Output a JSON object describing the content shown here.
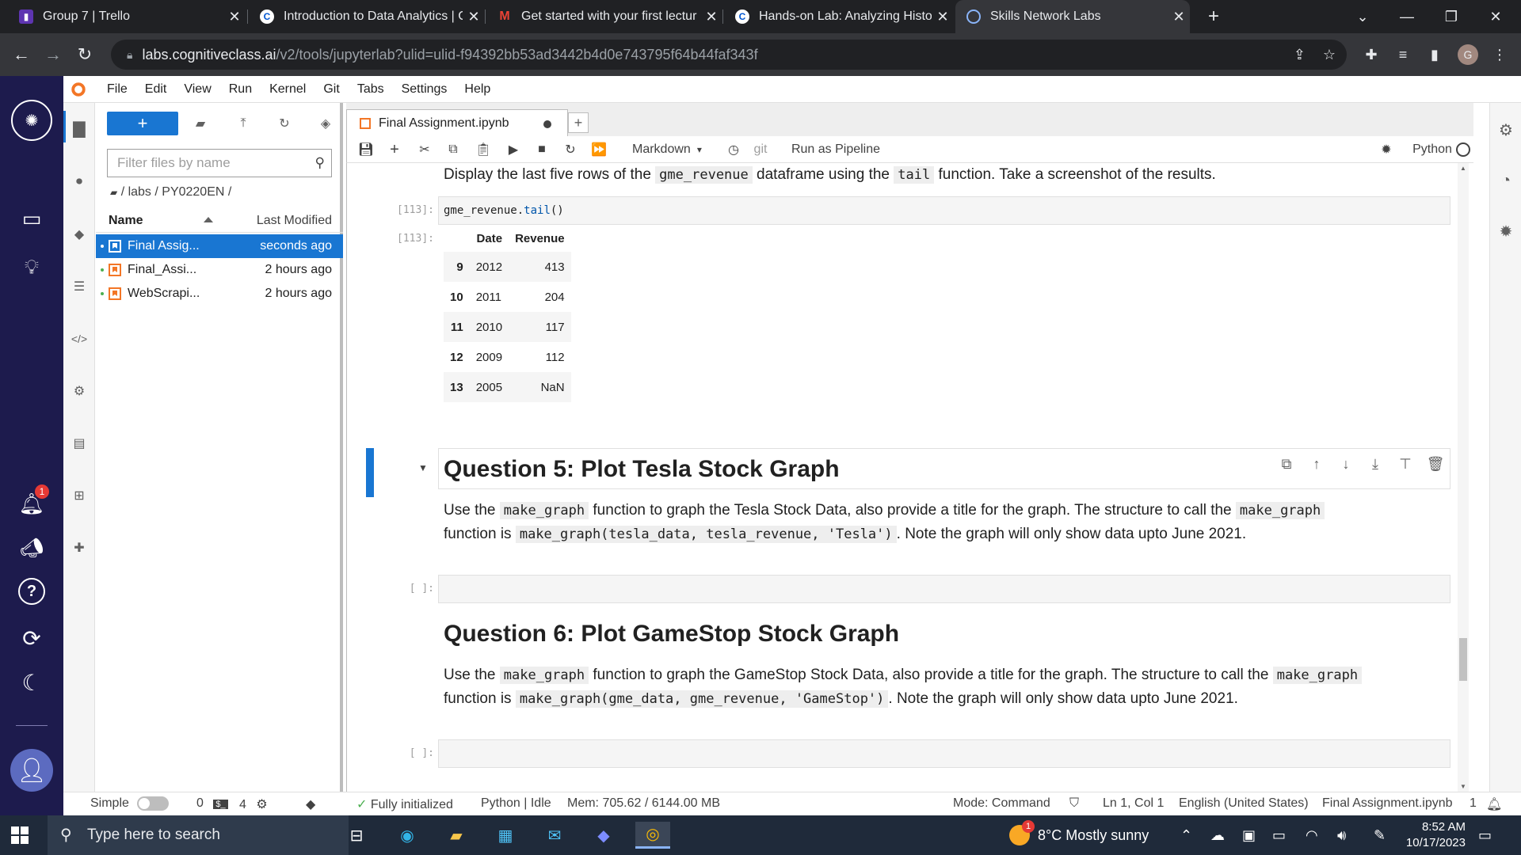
{
  "browser": {
    "tabs": [
      {
        "title": "Group 7 | Trello",
        "icon": "trello-icon",
        "color": "#5e35b1"
      },
      {
        "title": "Introduction to Data Analytics | C",
        "icon": "coursera-icon",
        "color": "#0056d2"
      },
      {
        "title": "Get started with your first lectur",
        "icon": "gmail-icon",
        "color": "#ea4335"
      },
      {
        "title": "Hands-on Lab: Analyzing Histori",
        "icon": "coursera-icon",
        "color": "#0056d2"
      },
      {
        "title": "Skills Network Labs",
        "icon": "skills-network-icon",
        "color": "#8ab4f8"
      }
    ],
    "url_host": "labs.cognitiveclass.ai",
    "url_path": "/v2/tools/jupyterlab?ulid=ulid-f94392bb53ad3442b4d0e743795f64b44faf343f",
    "profile_initial": "G"
  },
  "menu": [
    "File",
    "Edit",
    "View",
    "Run",
    "Kernel",
    "Git",
    "Tabs",
    "Settings",
    "Help"
  ],
  "rail": {
    "notification_count": "1"
  },
  "filebrowser": {
    "filter_placeholder": "Filter files by name",
    "breadcrumb": "/ labs / PY0220EN /",
    "col_name": "Name",
    "col_modified": "Last Modified",
    "files": [
      {
        "name": "Final Assig...",
        "modified": "seconds ago"
      },
      {
        "name": "Final_Assi...",
        "modified": "2 hours ago"
      },
      {
        "name": "WebScrapi...",
        "modified": "2 hours ago"
      }
    ]
  },
  "notebook": {
    "tab_title": "Final Assignment.ipynb",
    "cell_type": "Markdown",
    "git_label": "git",
    "pipeline_label": "Run as Pipeline",
    "kernel": "Python",
    "intro_text": {
      "a": "Display the last five rows of the",
      "b": "gme_revenue",
      "c": "dataframe using the",
      "d": "tail",
      "e": "function. Take a screenshot of the results."
    },
    "cell113": {
      "prompt_in": "[113]:",
      "prompt_out": "[113]:",
      "code_obj": "gme_revenue.",
      "code_fn": "tail",
      "code_end": "()"
    },
    "table": {
      "headers": [
        "Date",
        "Revenue"
      ],
      "rows": [
        {
          "idx": "9",
          "date": "2012",
          "rev": "413"
        },
        {
          "idx": "10",
          "date": "2011",
          "rev": "204"
        },
        {
          "idx": "11",
          "date": "2010",
          "rev": "117"
        },
        {
          "idx": "12",
          "date": "2009",
          "rev": "112"
        },
        {
          "idx": "13",
          "date": "2005",
          "rev": "NaN"
        }
      ]
    },
    "q5": {
      "heading": "Question 5: Plot Tesla Stock Graph",
      "l1a": "Use the",
      "l1b": "make_graph",
      "l1c": "function to graph the Tesla Stock Data, also provide a title for the graph. The structure to call the",
      "l1d": "make_graph",
      "l2a": "function is",
      "l2b": "make_graph(tesla_data, tesla_revenue, 'Tesla')",
      "l2c": ". Note the graph will only show data upto June 2021.",
      "prompt": "[ ]:"
    },
    "q6": {
      "heading": "Question 6: Plot GameStop Stock Graph",
      "l1a": "Use the",
      "l1b": "make_graph",
      "l1c": "function to graph the GameStop Stock Data, also provide a title for the graph. The structure to call the",
      "l1d": "make_graph",
      "l2a": "function is",
      "l2b": "make_graph(gme_data, gme_revenue, 'GameStop')",
      "l2c": ". Note the graph will only show data upto June 2021.",
      "prompt": "[ ]:"
    }
  },
  "status": {
    "mode_label": "Simple",
    "num0": "0",
    "num4": "4",
    "init": "Fully initialized",
    "kernel": "Python | Idle",
    "mem": "Mem: 705.62 / 6144.00 MB",
    "mode": "Mode: Command",
    "cursor": "Ln 1, Col 1",
    "lang": "English (United States)",
    "file": "Final Assignment.ipynb",
    "count": "1"
  },
  "taskbar": {
    "search_placeholder": "Type here to search",
    "weather": "8°C  Mostly sunny",
    "time": "8:52 AM",
    "date": "10/17/2023",
    "weather_badge": "1"
  },
  "colors": {
    "accent": "#1976d2",
    "rail": "#1d1b4d",
    "jupyter_orange": "#f37626"
  }
}
